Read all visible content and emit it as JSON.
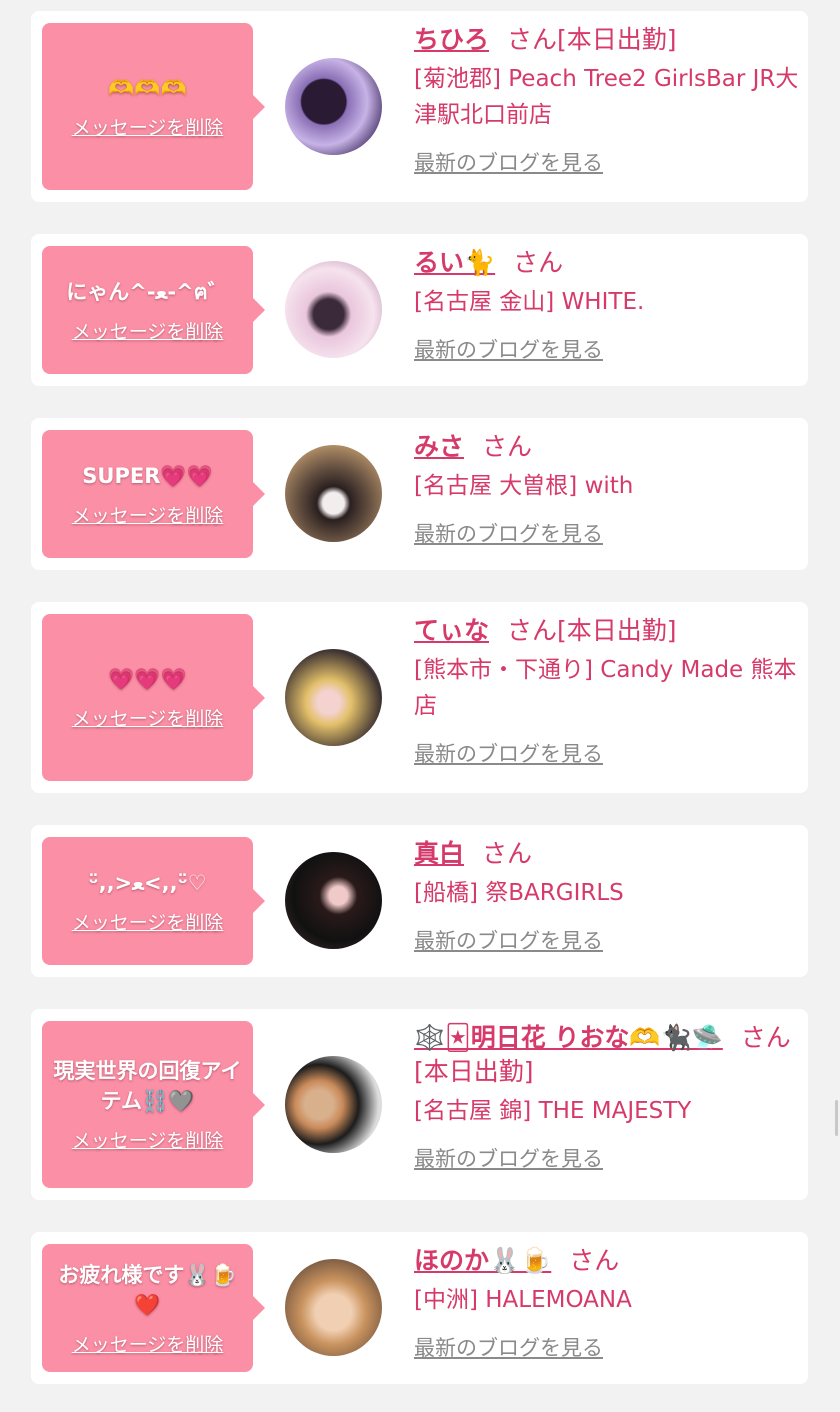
{
  "delete_label": "メッセージを削除",
  "blog_label": "最新のブログを見る",
  "san_label": "さん",
  "colors": {
    "accent": "#d63a6a",
    "bubble": "#fb8fa5",
    "link_gray": "#8a8a8a",
    "background": "#f2f2f2"
  },
  "items": [
    {
      "message": "🫶🫶🫶",
      "name": "ちひろ",
      "duty": "[本日出勤]",
      "shop": "[菊池郡] Peach Tree2 GirlsBar JR大津駅北口前店"
    },
    {
      "message": "にゃん^-ﻌ-^ฅ゛",
      "name": "るい🐈",
      "duty": "",
      "shop": "[名古屋 金山] WHITE."
    },
    {
      "message": "SUPER💗💗",
      "name": "みさ",
      "duty": "",
      "shop": "[名古屋 大曽根] with"
    },
    {
      "message": "💗💗💗",
      "name": "てぃな",
      "duty": "[本日出勤]",
      "shop": "[熊本市・下通り] Candy Made 熊本店"
    },
    {
      "message": "ᵕ̈,,>ﻌ<,,ᵕ̈♡",
      "name": "真白",
      "duty": "",
      "shop": "[船橋] 祭BARGIRLS"
    },
    {
      "message": "現実世界の回復アイテム⛓️🩶",
      "name": "🕸️🃏明日花 りおな🫶🐈‍⬛🛸",
      "duty": "[本日出勤]",
      "shop": "[名古屋 錦] THE MAJESTY"
    },
    {
      "message": "お疲れ様です🐰🍺❤️",
      "name": "ほのか🐰🍺",
      "duty": "",
      "shop": "[中洲] HALEMOANA"
    }
  ]
}
